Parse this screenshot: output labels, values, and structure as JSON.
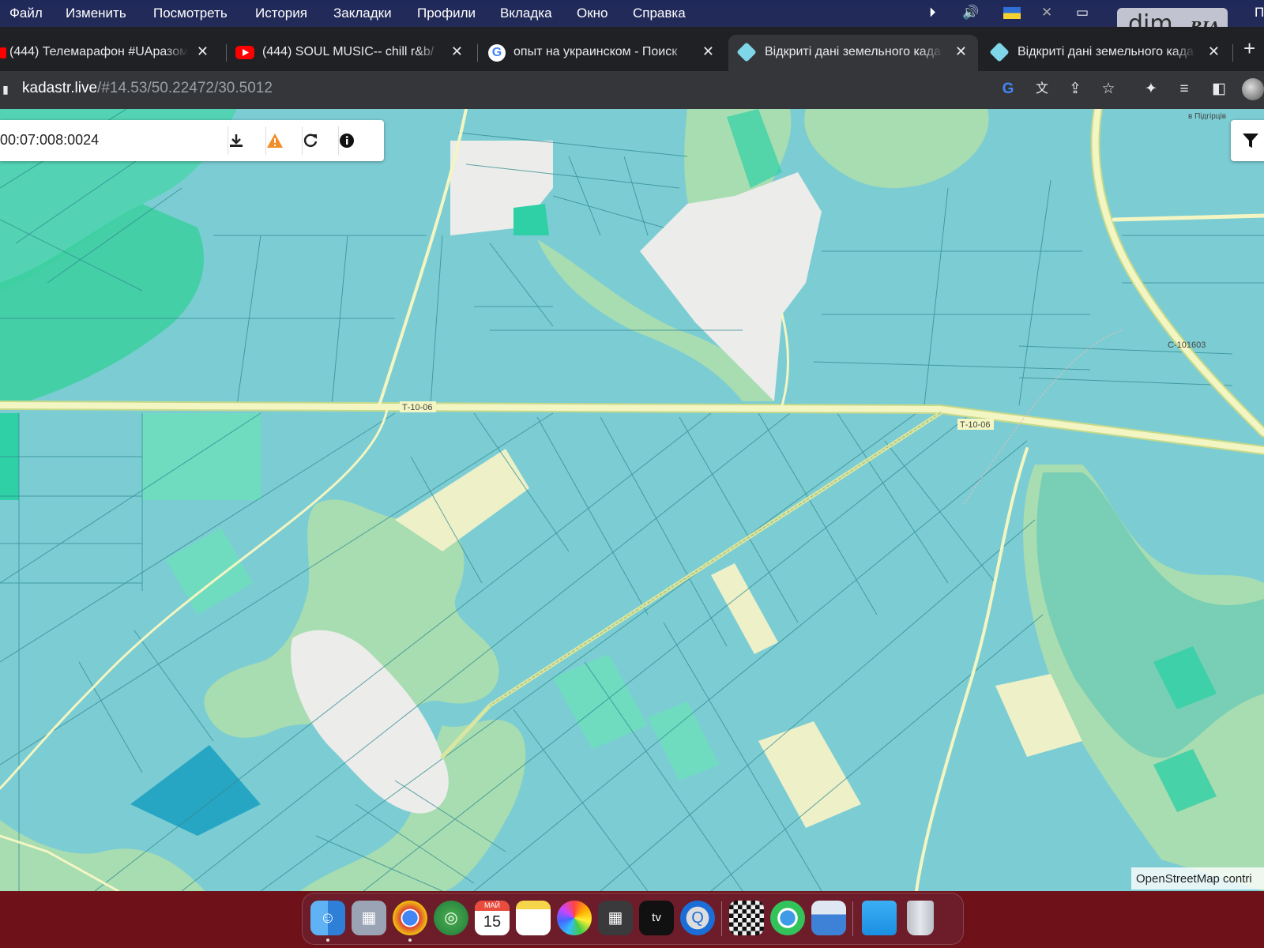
{
  "menubar": {
    "items": [
      "Файл",
      "Изменить",
      "Посмотреть",
      "История",
      "Закладки",
      "Профили",
      "Вкладка",
      "Окно",
      "Справка"
    ],
    "watermark_brand": "dim",
    "watermark_sub": "RIA"
  },
  "tabs": [
    {
      "title": "(444) Телемарафон #UAразом",
      "favicon": "youtube-icon",
      "active": false
    },
    {
      "title": "(444) SOUL MUSIC-- chill r&b/",
      "favicon": "youtube-icon",
      "active": false
    },
    {
      "title": "опыт на украинском - Поиск",
      "favicon": "google-icon",
      "active": false
    },
    {
      "title": "Відкриті дані земельного када",
      "favicon": "kadastr-icon",
      "active": true
    },
    {
      "title": "Відкриті дані земельного када",
      "favicon": "kadastr-icon",
      "active": false
    }
  ],
  "toolbar": {
    "url_host": "kadastr.live",
    "url_path": "/#14.53/50.22472/30.5012"
  },
  "map": {
    "search_value": "00:07:008:0024",
    "tools": [
      "download-icon",
      "warning-icon",
      "refresh-icon",
      "info-icon"
    ],
    "road_labels": [
      "Т-10-06",
      "Т-10-06",
      "С-101603",
      "в Підгірців"
    ],
    "attribution": "OpenStreetMap contri",
    "colors": {
      "parcel": "#7ccdd3",
      "parcel_alt": "#6fdcc0",
      "forest": "#a8dcb1",
      "road": "#f3f5c2",
      "settlement": "#ececea",
      "field": "#eef0c8",
      "highlight": "#27a6c4"
    }
  },
  "dock": {
    "apps": [
      "finder-icon",
      "launchpad-icon",
      "chrome-icon",
      "globe-app-icon",
      "calendar-icon",
      "notes-icon",
      "photos-icon",
      "calculator-icon",
      "apple-tv-icon",
      "quicktime-icon",
      "chess-icon",
      "find-my-icon",
      "preview-icon",
      "folder-icon",
      "trash-icon"
    ],
    "calendar_month": "МАЙ",
    "calendar_day": "15",
    "tv_label": "tv"
  }
}
